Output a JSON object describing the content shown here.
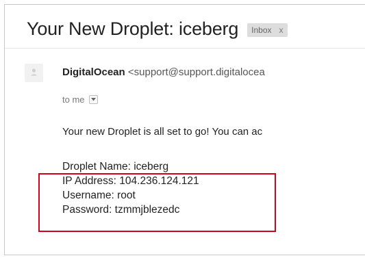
{
  "email": {
    "subject": "Your New Droplet: iceberg",
    "label": {
      "text": "Inbox",
      "close": "x"
    },
    "sender": {
      "name": "DigitalOcean",
      "email": "<support@support.digitalocea"
    },
    "recipient_line": "to me",
    "body_intro": "Your new Droplet is all set to go! You can ac",
    "details": {
      "droplet_name": "Droplet Name: iceberg",
      "ip_address": "IP Address: 104.236.124.121",
      "username": "Username: root",
      "password": "Password: tzmmjblezedc"
    }
  },
  "icons": {
    "avatar": "default-avatar-icon",
    "toggle": "chevron-down-icon"
  },
  "colors": {
    "highlight_box": "#d0021b",
    "label_chip_bg": "#dddddd",
    "avatar_bg": "#f1f1f1"
  }
}
